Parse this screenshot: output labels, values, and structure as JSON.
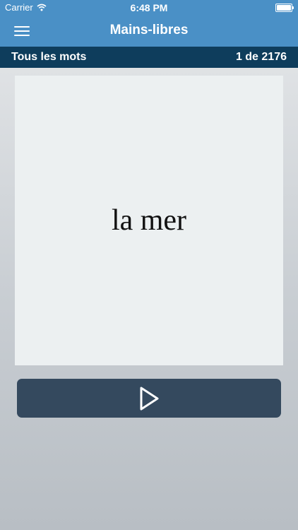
{
  "status_bar": {
    "carrier": "Carrier",
    "time": "6:48 PM"
  },
  "nav": {
    "title": "Mains-libres",
    "menu_icon": "hamburger-menu-icon"
  },
  "sub_header": {
    "list_name": "Tous les mots",
    "counter": "1 de 2176"
  },
  "card": {
    "word": "la mer"
  },
  "controls": {
    "play_icon": "play-icon"
  },
  "colors": {
    "nav_bar": "#4a90c6",
    "sub_header": "#0e3d5c",
    "card": "#ecf0f1",
    "play_button": "#34495e"
  }
}
